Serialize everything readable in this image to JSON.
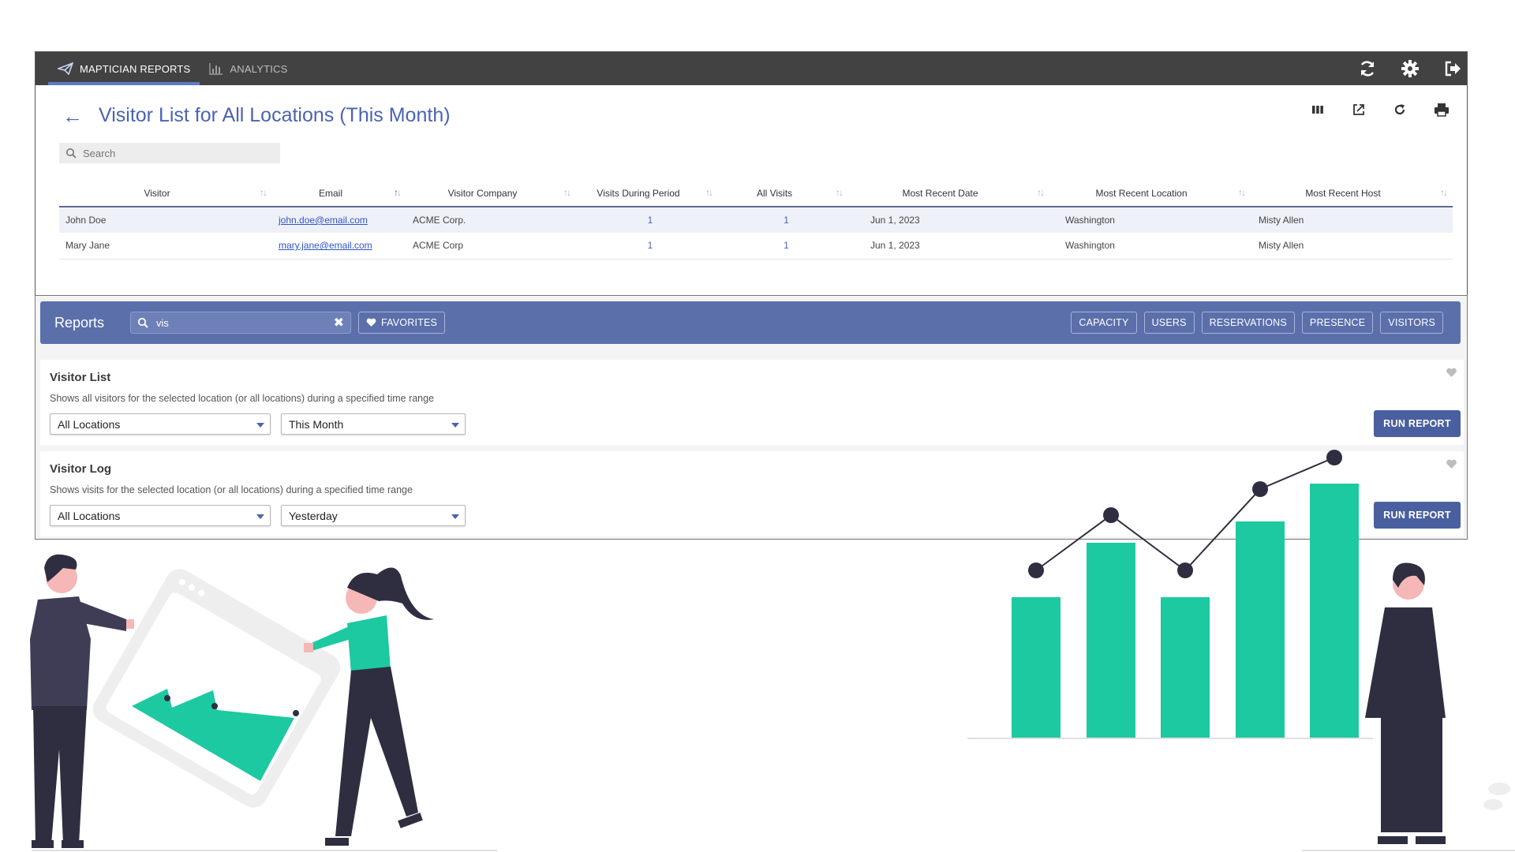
{
  "topnav": {
    "tabs": [
      {
        "label": "MAPTICIAN REPORTS",
        "icon": "paper-plane-icon",
        "active": true
      },
      {
        "label": "ANALYTICS",
        "icon": "bar-chart-icon",
        "active": false
      }
    ],
    "right_icons": [
      "refresh-icon",
      "gear-icon",
      "sign-out-icon"
    ]
  },
  "page": {
    "title": "Visitor List for All Locations (This Month)",
    "search_placeholder": "Search",
    "toolbar_icons": [
      "columns-icon",
      "export-icon",
      "reload-icon",
      "print-icon"
    ]
  },
  "table": {
    "headers": [
      "Visitor",
      "Email",
      "Visitor Company",
      "Visits During Period",
      "All Visits",
      "Most Recent Date",
      "Most Recent Location",
      "Most Recent Host"
    ],
    "rows": [
      {
        "visitor": "John Doe",
        "email": "john.doe@email.com",
        "company": "ACME Corp.",
        "visits_period": "1",
        "all_visits": "1",
        "recent_date": "Jun 1, 2023",
        "recent_location": "Washington",
        "recent_host": "Misty Allen"
      },
      {
        "visitor": "Mary Jane",
        "email": "mary.jane@email.com",
        "company": "ACME Corp",
        "visits_period": "1",
        "all_visits": "1",
        "recent_date": "Jun 1, 2023",
        "recent_location": "Washington",
        "recent_host": "Misty Allen"
      }
    ]
  },
  "reports": {
    "title": "Reports",
    "filter_value": "vis",
    "favorites_label": "FAVORITES",
    "categories": [
      "CAPACITY",
      "USERS",
      "RESERVATIONS",
      "PRESENCE",
      "VISITORS"
    ],
    "cards": [
      {
        "name": "Visitor List",
        "description": "Shows all visitors for the selected location (or all locations) during a specified time range",
        "location": "All Locations",
        "range": "This Month",
        "run_label": "RUN REPORT"
      },
      {
        "name": "Visitor Log",
        "description": "Shows visits for the selected location (or all locations) during a specified time range",
        "location": "All Locations",
        "range": "Yesterday",
        "run_label": "RUN REPORT"
      }
    ]
  },
  "colors": {
    "accent": "#4a63b5",
    "header_bar": "#5b6fab",
    "nav": "#424242",
    "illustration_green": "#1dc9a0",
    "illustration_dark": "#2f2e41"
  }
}
